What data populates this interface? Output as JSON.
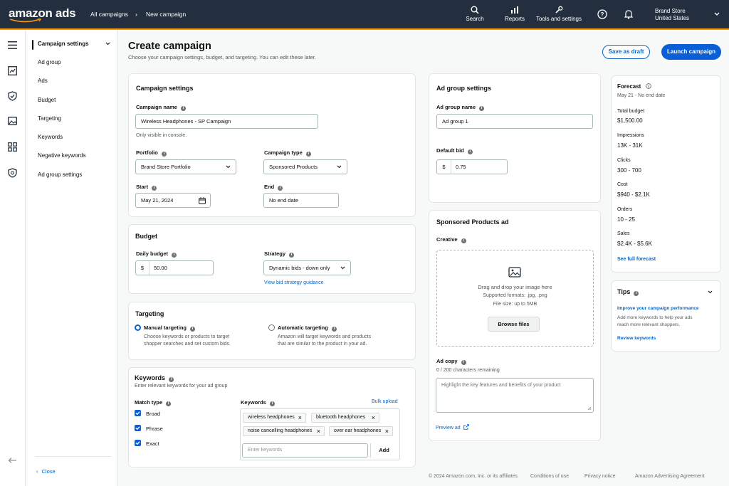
{
  "header": {
    "logo": "amazon ads",
    "breadcrumbs": [
      "All campaigns",
      "New campaign"
    ],
    "search_label": "Search",
    "reports_label": "Reports",
    "tools_label": "Tools and settings",
    "account_name": "Brand Store",
    "account_region": "United States"
  },
  "sidenav": {
    "items": [
      "Campaign settings",
      "Ad group",
      "Ads",
      "Budget",
      "Targeting",
      "Keywords",
      "Negative keywords",
      "Ad group settings"
    ],
    "close_label": "Close"
  },
  "page": {
    "title": "Create campaign",
    "subtitle": "Choose your campaign settings, budget, and targeting. You can edit these later.",
    "save_draft_label": "Save as draft",
    "launch_label": "Launch campaign"
  },
  "campaign_settings": {
    "title": "Campaign settings",
    "name_label": "Campaign name",
    "name_value": "Wireless Headphones - SP Campaign",
    "name_hint": "Only visible in console.",
    "portfolio_label": "Portfolio",
    "portfolio_value": "Brand Store Portfolio",
    "type_label": "Campaign type",
    "type_value": "Sponsored Products",
    "start_label": "Start",
    "start_value": "May 21, 2024",
    "end_label": "End",
    "end_value": "No end date"
  },
  "budget": {
    "title": "Budget",
    "daily_label": "Daily budget",
    "currency": "$",
    "daily_value": "50.00",
    "strategy_label": "Strategy",
    "strategy_value": "Dynamic bids - down only",
    "guidance_link": "View bid strategy guidance"
  },
  "targeting": {
    "title": "Targeting",
    "manual_label": "Manual targeting",
    "manual_desc_1": "Choose keywords or products to target",
    "manual_desc_2": "shopper searches and set custom bids.",
    "auto_label": "Automatic targeting",
    "auto_desc_1": "Amazon will target keywords and products",
    "auto_desc_2": "that are similar to the product in your ad."
  },
  "keywords": {
    "title": "Keywords",
    "subtitle": "Enter relevant keywords for your ad group",
    "match_type_label": "Match type",
    "match_types": [
      "Broad",
      "Phrase",
      "Exact"
    ],
    "keywords_label": "Keywords",
    "bulk_upload": "Bulk upload",
    "chips": [
      "wireless headphones",
      "bluetooth headphones",
      "noise cancelling headphones",
      "over ear headphones"
    ],
    "input_placeholder": "Enter keywords",
    "add_label": "Add"
  },
  "ad_group": {
    "title": "Ad group settings",
    "name_label": "Ad group name",
    "name_value": "Ad group 1",
    "bid_label": "Default bid",
    "currency": "$",
    "bid_value": "0.75"
  },
  "sp_ad": {
    "title": "Sponsored Products ad",
    "creative_label": "Creative",
    "drop_text": "Drag and drop your image here",
    "formats": "Supported formats: .jpg, .png",
    "file_size": "File size: up to 5MB",
    "browse_label": "Browse files",
    "ad_copy_label": "Ad copy",
    "char_count": "0 / 200 characters remaining",
    "ad_copy_placeholder": "Highlight the key features and benefits of your product",
    "preview_link": "Preview ad"
  },
  "forecast": {
    "title": "Forecast",
    "date_range": "May 21 - No end date",
    "metrics": [
      {
        "label": "Total budget",
        "value": "$1,500.00"
      },
      {
        "label": "Impressions",
        "value": "13K - 31K"
      },
      {
        "label": "Clicks",
        "value": "300 - 700"
      },
      {
        "label": "Cost",
        "value": "$940 - $2.1K"
      },
      {
        "label": "Orders",
        "value": "10 - 25"
      },
      {
        "label": "Sales",
        "value": "$2.4K - $5.6K"
      }
    ],
    "full_forecast_link": "See full forecast"
  },
  "tips": {
    "title": "Tips",
    "heading": "Improve your campaign performance",
    "text_1": "Add more keywords to help your ads",
    "text_2": "reach more relevant shoppers.",
    "link": "Review keywords"
  },
  "footer": {
    "copyright": "© 2024 Amazon.com, Inc. or its affiliates.",
    "conditions": "Conditions of use",
    "privacy": "Privacy notice",
    "agreement": "Amazon Advertising Agreement"
  }
}
